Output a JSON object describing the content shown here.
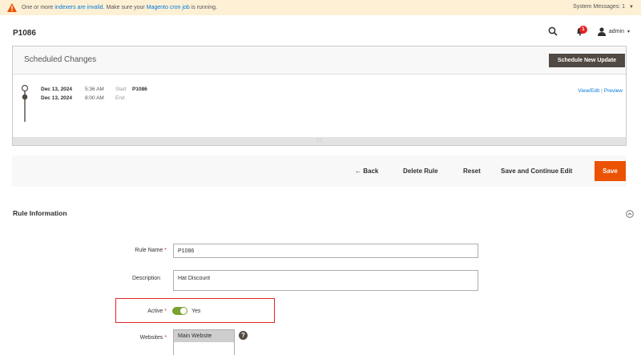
{
  "system_bar": {
    "text_prefix": "One or more ",
    "link_indexers": "indexers are invalid",
    "text_middle": ". Make sure your ",
    "link_cron": "Magento cron job",
    "text_suffix": " is running.",
    "messages_label": "System Messages: 1",
    "caret": "▼"
  },
  "header": {
    "page_title": "P1086",
    "notifications_count": "1",
    "user_label": "admin",
    "caret": "▾"
  },
  "scheduled_changes": {
    "title": "Scheduled Changes",
    "new_update_button": "Schedule New Update",
    "entries": [
      {
        "date": "Dec 13, 2024",
        "time": "5:36 AM",
        "kind": "Start",
        "name": "P1086"
      },
      {
        "date": "Dec 13, 2024",
        "time": "8:00 AM",
        "kind": "End",
        "name": ""
      }
    ],
    "link_view_edit": "View/Edit",
    "link_separator": "|",
    "link_preview": "Preview",
    "resize_handle": "::::"
  },
  "toolbar": {
    "back_label": "← Back",
    "delete_label": "Delete Rule",
    "reset_label": "Reset",
    "save_continue_label": "Save and Continue Edit",
    "save_label": "Save"
  },
  "rule_information": {
    "title": "Rule Information",
    "rule_name_label": "Rule Name",
    "rule_name_value": "P1086",
    "description_label": "Description",
    "description_value": "Hat Discount",
    "active_label": "Active",
    "active_value": "Yes",
    "websites_label": "Websites",
    "websites_options": [
      "Main Website"
    ],
    "required_marker": "*",
    "help_icon_text": "?"
  },
  "colors": {
    "accent_orange": "#eb5202",
    "dark_button": "#514943",
    "link_blue": "#007bdb",
    "toggle_green": "#79a22e",
    "highlight_red": "#e22626",
    "sysbar_bg": "#fdf0d5"
  },
  "icons": [
    "warning-icon",
    "search-icon",
    "bell-icon",
    "user-icon",
    "collapse-icon",
    "help-icon",
    "timeline-icon"
  ]
}
